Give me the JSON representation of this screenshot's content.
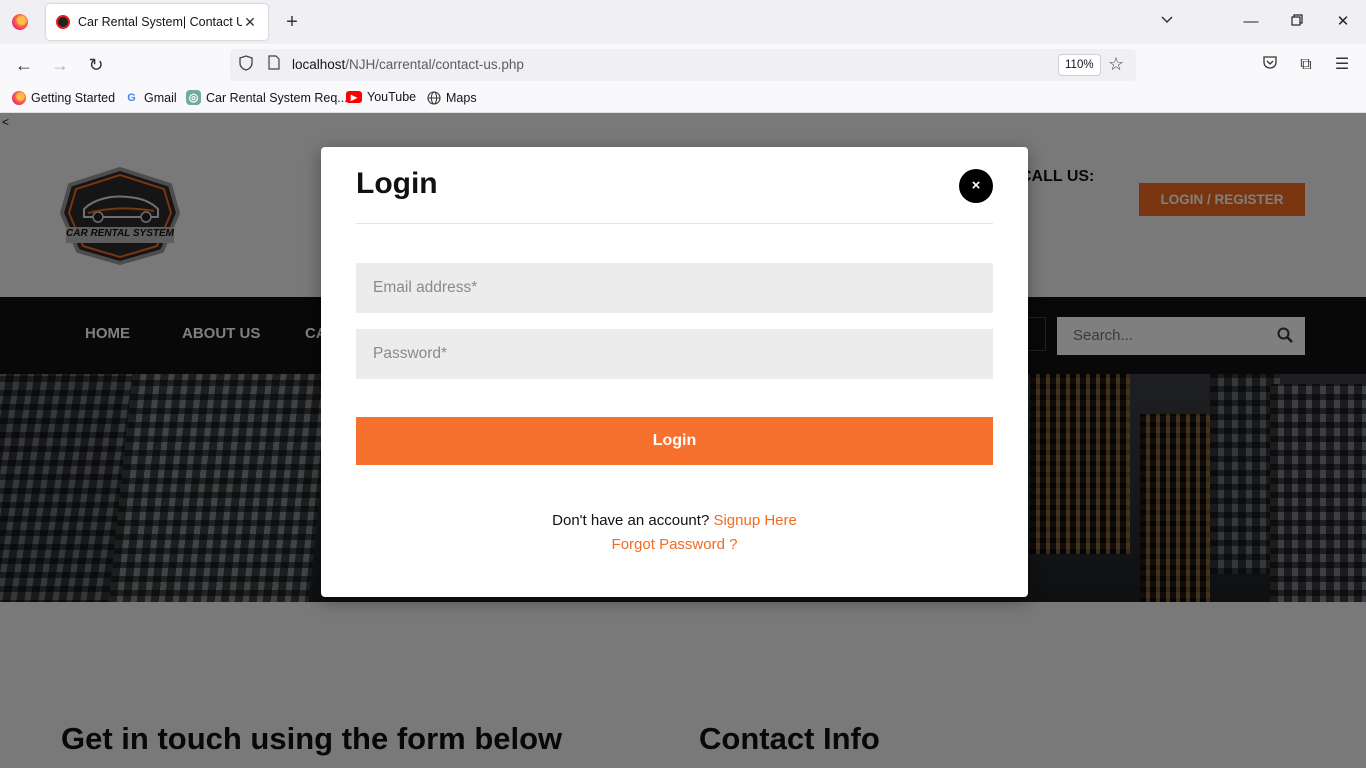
{
  "browser": {
    "tab_title": "Car Rental System| Contact Us P",
    "url_host": "localhost",
    "url_path": "/NJH/carrental/contact-us.php",
    "zoom": "110%",
    "bookmarks": [
      {
        "label": "Getting Started"
      },
      {
        "label": "Gmail"
      },
      {
        "label": "Car Rental System Req..."
      },
      {
        "label": "YouTube"
      },
      {
        "label": "Maps"
      }
    ]
  },
  "site": {
    "stray_char": "<",
    "logo_text": "CAR RENTAL SYSTEM",
    "call_us": "CALL US:",
    "login_register": "LOGIN / REGISTER",
    "nav": [
      {
        "label": "HOME"
      },
      {
        "label": "ABOUT US"
      },
      {
        "label": "CA"
      }
    ],
    "search_placeholder": "Search...",
    "section_left_title": "Get in touch using the form below",
    "section_right_title": "Contact Info"
  },
  "modal": {
    "title": "Login",
    "close_label": "×",
    "email_placeholder": "Email address*",
    "password_placeholder": "Password*",
    "login_button": "Login",
    "no_account_text": "Don't have an account?",
    "signup_link": "Signup Here",
    "forgot_link": "Forgot Password ?"
  },
  "colors": {
    "accent": "#f26b21",
    "nav_bg": "#111111",
    "overlay": "rgba(0,0,0,0.5)"
  }
}
